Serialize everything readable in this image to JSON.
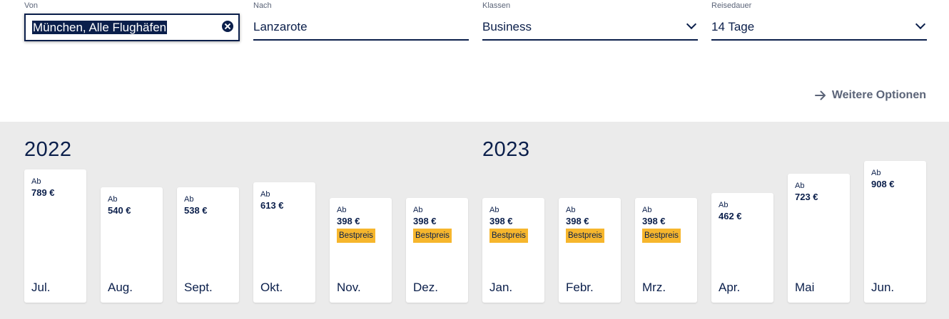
{
  "search": {
    "from": {
      "label": "Von",
      "value": "München, Alle Flughäfen"
    },
    "to": {
      "label": "Nach",
      "value": "Lanzarote"
    },
    "class": {
      "label": "Klassen",
      "value": "Business"
    },
    "duration": {
      "label": "Reisedauer",
      "value": "14 Tage"
    }
  },
  "more_options": "Weitere Optionen",
  "calendar": {
    "year_2022": "2022",
    "year_2023": "2023",
    "price_prefix": "Ab",
    "best_label": "Bestpreis",
    "months": [
      {
        "month": "Jul.",
        "price": "789 €",
        "best": false
      },
      {
        "month": "Aug.",
        "price": "540 €",
        "best": false
      },
      {
        "month": "Sept.",
        "price": "538 €",
        "best": false
      },
      {
        "month": "Okt.",
        "price": "613 €",
        "best": false
      },
      {
        "month": "Nov.",
        "price": "398 €",
        "best": true
      },
      {
        "month": "Dez.",
        "price": "398 €",
        "best": true
      },
      {
        "month": "Jan.",
        "price": "398 €",
        "best": true
      },
      {
        "month": "Febr.",
        "price": "398 €",
        "best": true
      },
      {
        "month": "Mrz.",
        "price": "398 €",
        "best": true
      },
      {
        "month": "Apr.",
        "price": "462 €",
        "best": false
      },
      {
        "month": "Mai",
        "price": "723 €",
        "best": false
      },
      {
        "month": "Jun.",
        "price": "908 €",
        "best": false
      }
    ]
  },
  "colors": {
    "primary": "#0b1f4b",
    "background": "#ebebeb",
    "best_badge": "#f6b62d",
    "secondary_text": "#5b6478"
  }
}
